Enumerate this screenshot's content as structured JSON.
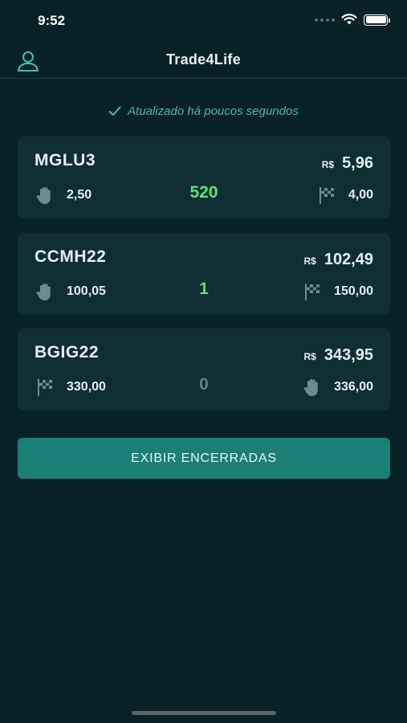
{
  "status_bar": {
    "time": "9:52"
  },
  "nav": {
    "title": "Trade4Life",
    "user_icon": "user-icon"
  },
  "update_status": {
    "text": "Atualizado há poucos segundos",
    "icon": "check-icon"
  },
  "colors": {
    "accent": "#1a7f75",
    "positive": "#5fe07a",
    "neutral": "#6f7f82",
    "check": "#4fb7a4"
  },
  "positions": [
    {
      "ticker": "MGLU3",
      "currency": "R$",
      "price": "5,96",
      "left": {
        "icon": "hand-icon",
        "value": "2,50"
      },
      "count": "520",
      "count_color": "#5fe07a",
      "right": {
        "icon": "flag-icon",
        "value": "4,00"
      }
    },
    {
      "ticker": "CCMH22",
      "currency": "R$",
      "price": "102,49",
      "left": {
        "icon": "hand-icon",
        "value": "100,05"
      },
      "count": "1",
      "count_color": "#5fe07a",
      "right": {
        "icon": "flag-icon",
        "value": "150,00"
      }
    },
    {
      "ticker": "BGIG22",
      "currency": "R$",
      "price": "343,95",
      "left": {
        "icon": "flag-icon",
        "value": "330,00"
      },
      "count": "0",
      "count_color": "#6f7f82",
      "right": {
        "icon": "hand-icon",
        "value": "336,00"
      }
    }
  ],
  "actions": {
    "show_closed_label": "EXIBIR ENCERRADAS"
  }
}
